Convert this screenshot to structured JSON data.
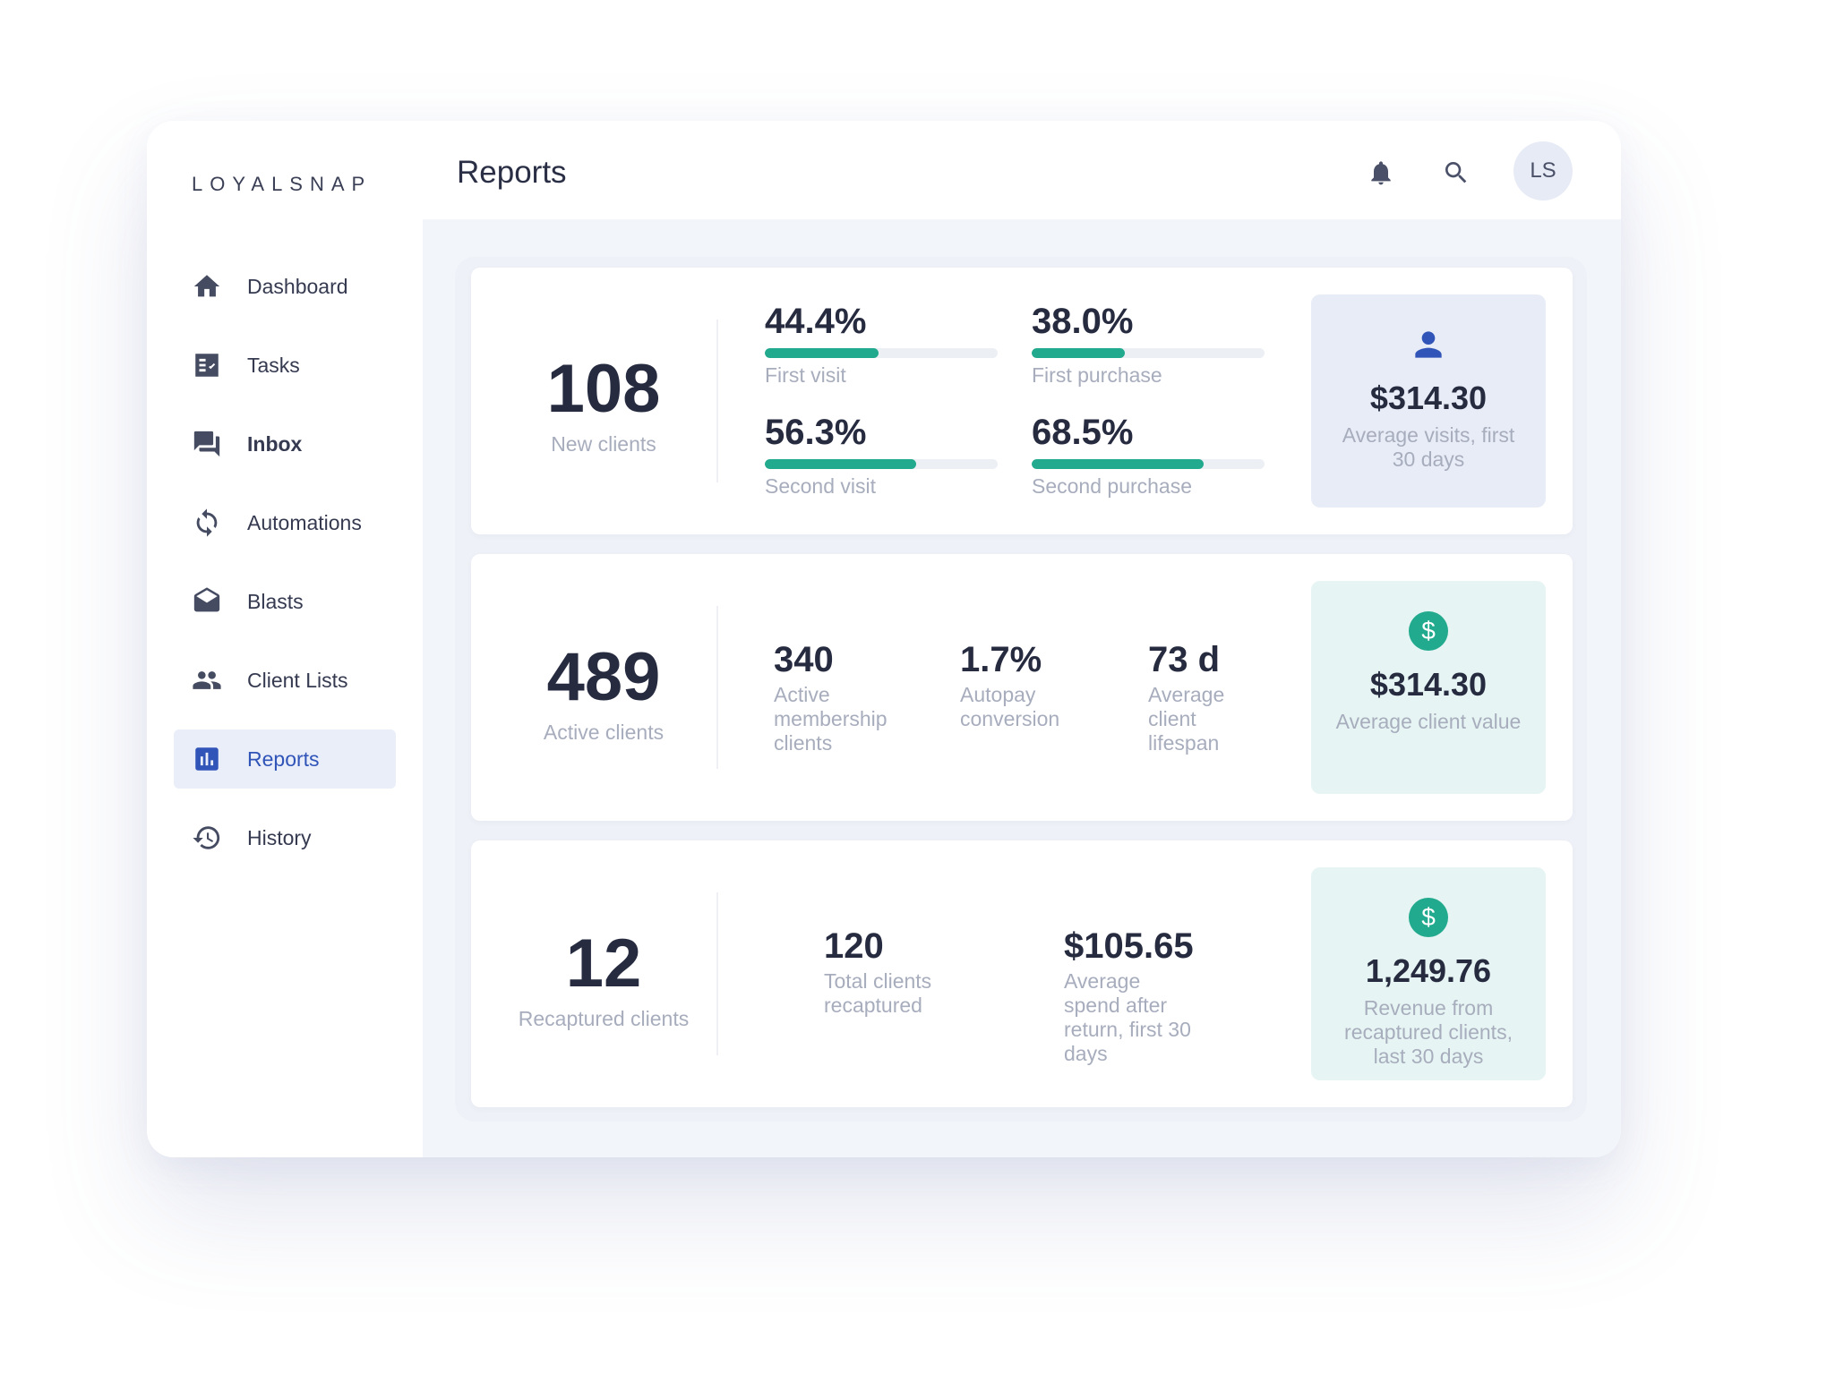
{
  "app": {
    "logo": "LOYALSNAP"
  },
  "sidebar": {
    "items": [
      {
        "label": "Dashboard",
        "icon": "home-icon"
      },
      {
        "label": "Tasks",
        "icon": "tasks-icon"
      },
      {
        "label": "Inbox",
        "icon": "chat-icon"
      },
      {
        "label": "Automations",
        "icon": "sync-icon"
      },
      {
        "label": "Blasts",
        "icon": "envelope-open-icon"
      },
      {
        "label": "Client Lists",
        "icon": "people-icon"
      },
      {
        "label": "Reports",
        "icon": "bar-chart-icon",
        "active": true
      },
      {
        "label": "History",
        "icon": "history-icon"
      }
    ]
  },
  "header": {
    "title": "Reports",
    "avatar_initials": "LS"
  },
  "colors": {
    "accent": "#3054b8",
    "progress": "#22aa8e",
    "active_bg": "#e9eef9"
  },
  "cards": {
    "new_clients": {
      "value": "108",
      "label": "New clients",
      "metrics": [
        {
          "value": "44.4%",
          "label": "First visit",
          "progress": 0.49
        },
        {
          "value": "38.0%",
          "label": "First purchase",
          "progress": 0.4
        },
        {
          "value": "56.3%",
          "label": "Second visit",
          "progress": 0.65
        },
        {
          "value": "68.5%",
          "label": "Second purchase",
          "progress": 0.74
        }
      ],
      "side": {
        "value": "$314.30",
        "label": "Average visits, first 30 days",
        "icon": "person-icon"
      }
    },
    "active_clients": {
      "value": "489",
      "label": "Active clients",
      "metrics": [
        {
          "value": "340",
          "label": "Active membership clients"
        },
        {
          "value": "1.7%",
          "label": "Autopay conversion"
        },
        {
          "value": "73 d",
          "label": "Average client lifespan"
        }
      ],
      "side": {
        "value": "$314.30",
        "label": "Average client value",
        "icon": "dollar-coin-icon"
      }
    },
    "recaptured_clients": {
      "value": "12",
      "label": "Recaptured clients",
      "metrics": [
        {
          "value": "120",
          "label": "Total clients recaptured"
        },
        {
          "value": "$105.65",
          "label": "Average spend after return, first 30 days"
        }
      ],
      "side": {
        "value": "1,249.76",
        "label": "Revenue from recaptured clients, last 30 days",
        "icon": "dollar-coin-icon"
      }
    }
  }
}
